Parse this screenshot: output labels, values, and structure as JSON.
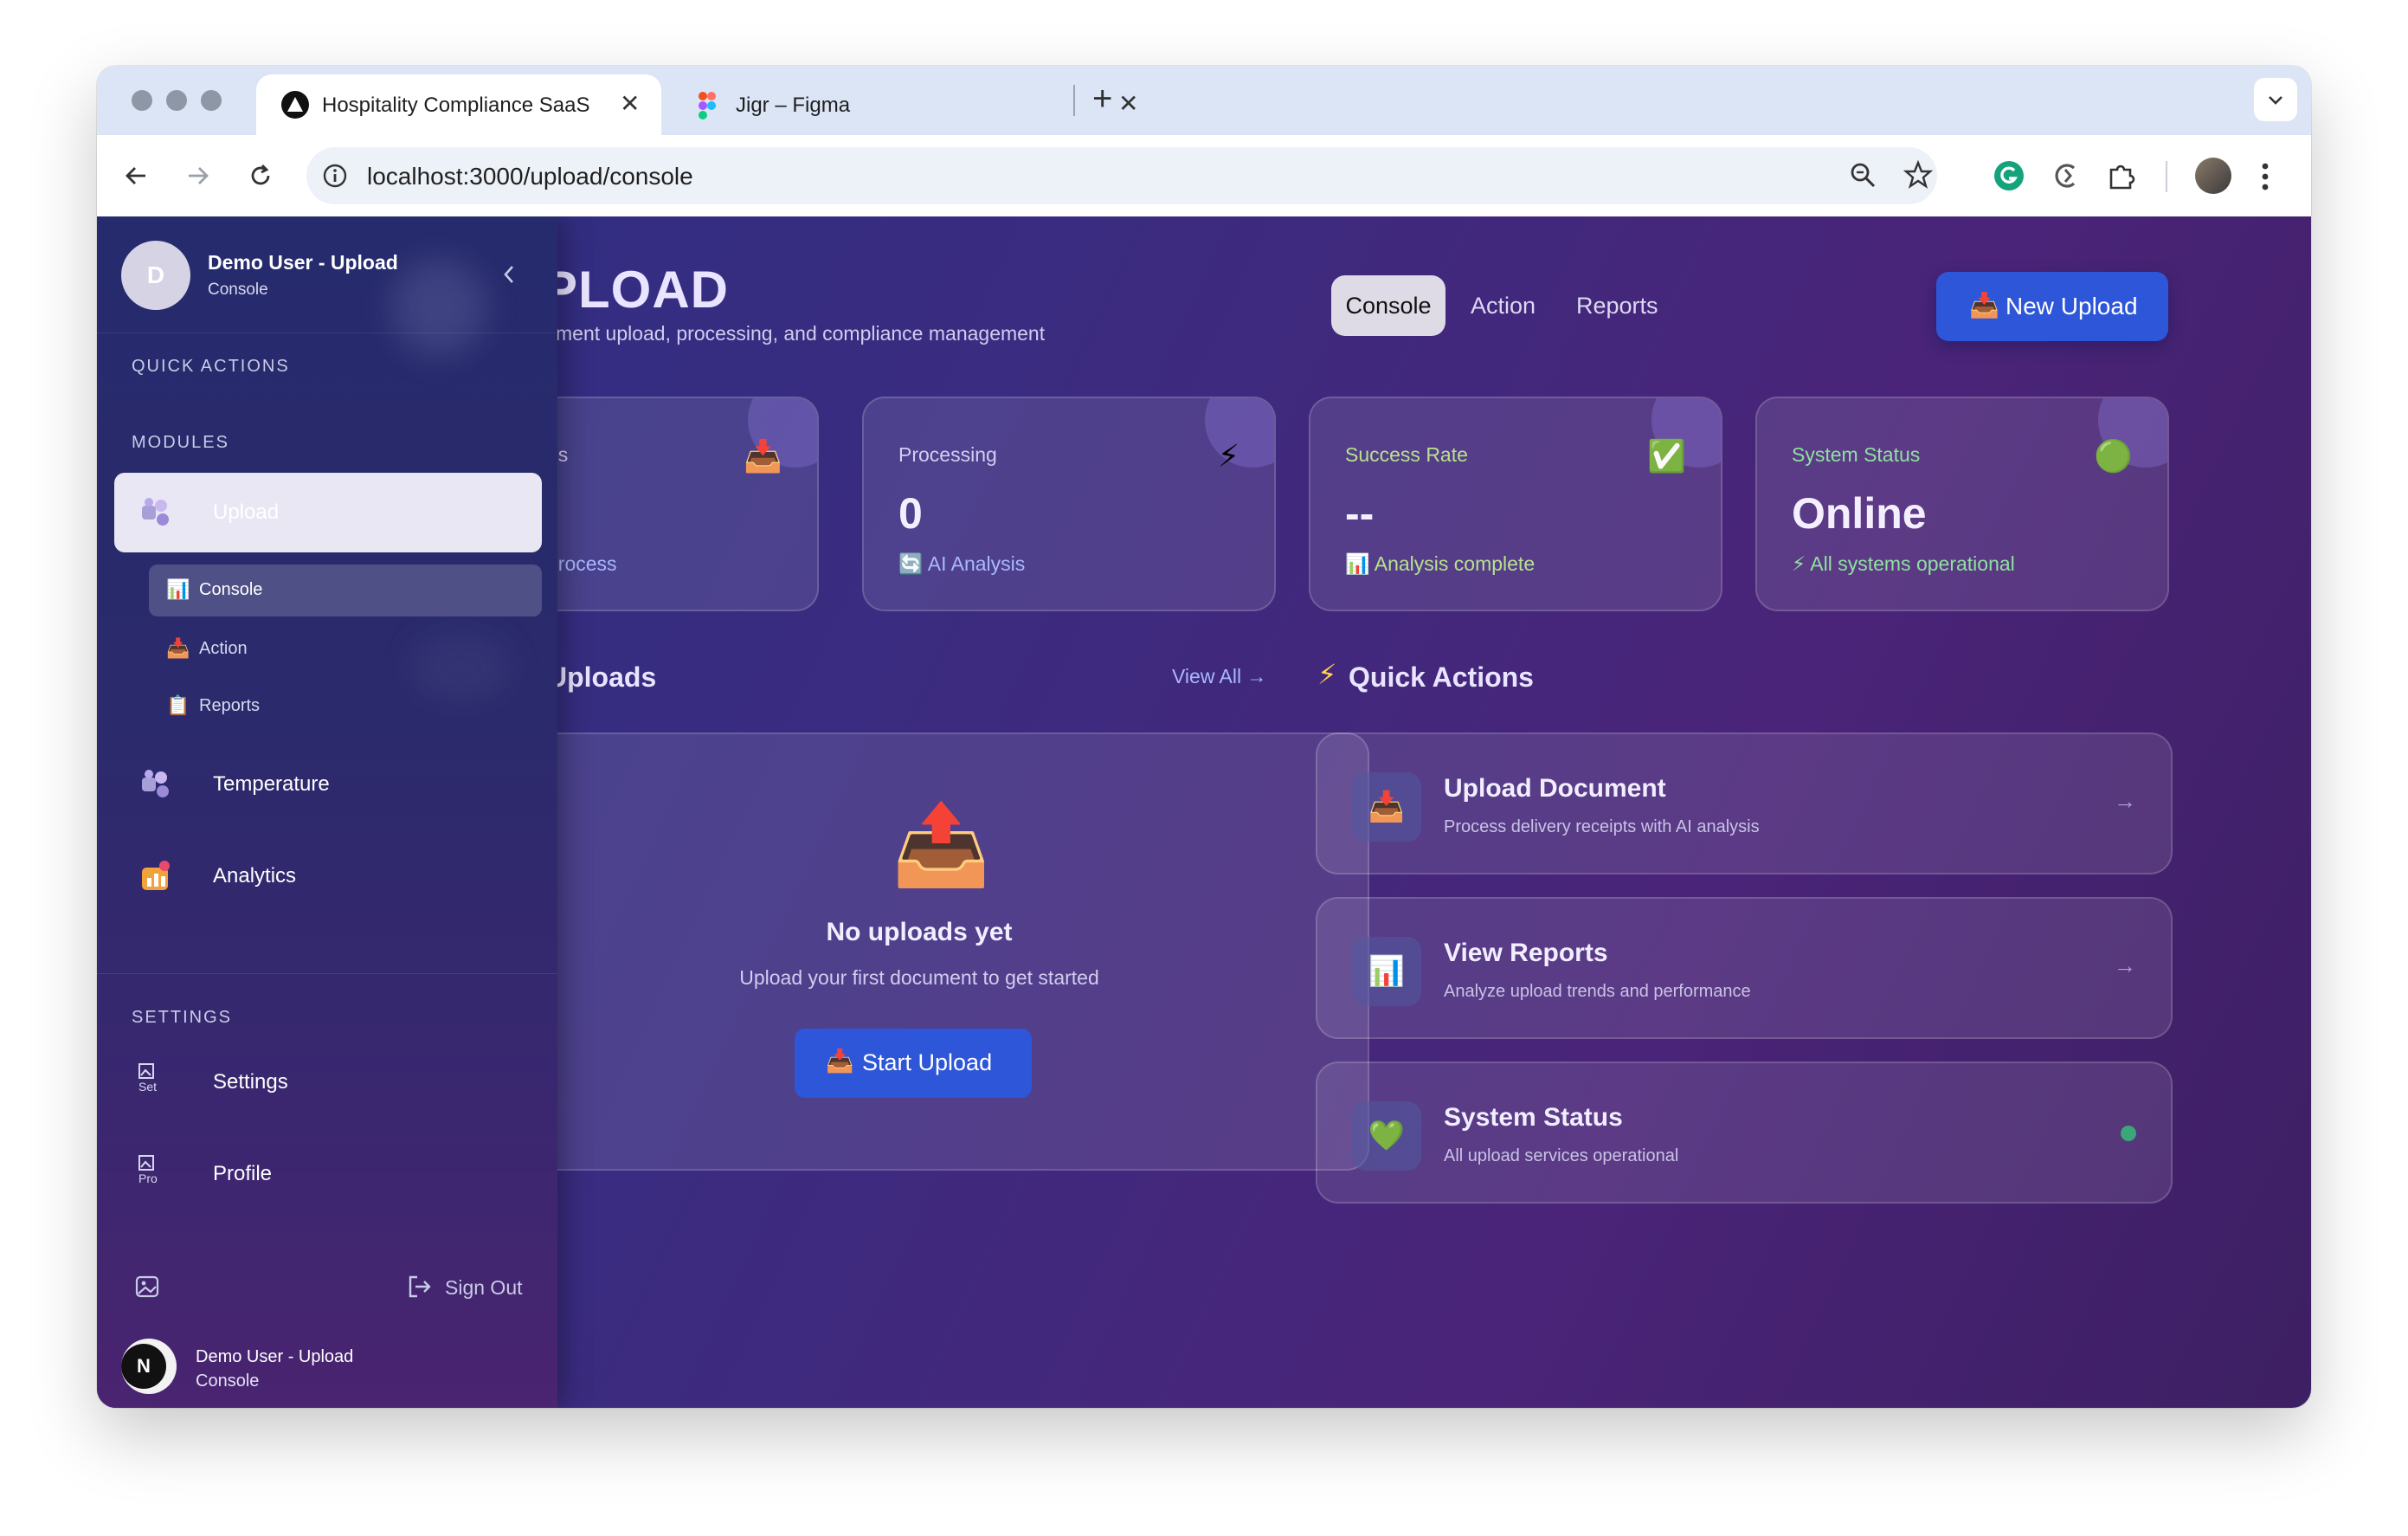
{
  "browser": {
    "tabs": [
      {
        "title": "Hospitality Compliance SaaS",
        "active": true,
        "icon": "triangle-logo-icon"
      },
      {
        "title": "Jigr – Figma",
        "active": false,
        "icon": "figma-icon"
      }
    ],
    "close_glyph": "✕",
    "new_tab_glyph": "+",
    "url": "localhost:3000/upload/console"
  },
  "sidebar": {
    "user": {
      "initial": "D",
      "name": "Demo User - Upload",
      "subtitle": "Console"
    },
    "quick_actions_heading": "QUICK ACTIONS",
    "modules_heading": "MODULES",
    "modules": [
      {
        "label": "Upload",
        "icon": "puzzle-icon",
        "active": true
      },
      {
        "label": "Temperature",
        "icon": "puzzle-icon",
        "active": false
      },
      {
        "label": "Analytics",
        "icon": "chart-box-icon",
        "active": false
      }
    ],
    "upload_subitems": [
      {
        "label": "Console",
        "icon": "📊",
        "active": true
      },
      {
        "label": "Action",
        "icon": "📥",
        "active": false
      },
      {
        "label": "Reports",
        "icon": "📋",
        "active": false
      }
    ],
    "settings_heading": "SETTINGS",
    "settings_items": [
      {
        "label": "Settings",
        "broken_img_alt": "Set"
      },
      {
        "label": "Profile",
        "broken_img_alt": "Pro"
      }
    ],
    "sign_out_label": "Sign Out",
    "footer_user": {
      "initial": "N",
      "name": "Demo User - Upload",
      "subtitle": "Console"
    }
  },
  "header": {
    "title_partial": "PLOAD",
    "subtitle_partial": "ment upload, processing, and compliance management",
    "tabs": [
      {
        "label": "Console",
        "active": true
      },
      {
        "label": "Action",
        "active": false
      },
      {
        "label": "Reports",
        "active": false
      }
    ],
    "new_upload_label": "New Upload",
    "new_upload_icon": "📥"
  },
  "stats": [
    {
      "label_partial": "ds",
      "value": "",
      "sub_partial": "process",
      "icon": "📥",
      "sub_color": "#a9b8ff"
    },
    {
      "label": "Processing",
      "value": "0",
      "sub": "🔄 AI Analysis",
      "icon": "⚡",
      "sub_color": "#a9b8ff"
    },
    {
      "label": "Success Rate",
      "value": "--",
      "sub": "📊 Analysis complete",
      "icon": "✅",
      "sub_color": "#b7e28c"
    },
    {
      "label": "System Status",
      "value": "Online",
      "sub": "⚡ All systems operational",
      "icon": "🟢",
      "sub_color": "#8fe0a0"
    }
  ],
  "recent_uploads": {
    "title_partial": "Uploads",
    "view_all": "View All →",
    "empty_icon": "📤",
    "empty_title": "No uploads yet",
    "empty_desc": "Upload your first document to get started",
    "start_button": "Start Upload",
    "start_icon": "📥"
  },
  "quick_actions": {
    "title": "Quick Actions",
    "title_icon": "⚡",
    "items": [
      {
        "title": "Upload Document",
        "desc": "Process delivery receipts with AI analysis",
        "icon": "📥",
        "trail": "→"
      },
      {
        "title": "View Reports",
        "desc": "Analyze upload trends and performance",
        "icon": "📊",
        "trail": "→"
      },
      {
        "title": "System Status",
        "desc": "All upload services operational",
        "icon": "💚",
        "trail": "dot"
      }
    ]
  },
  "colors": {
    "accent_button": "#2e56d8",
    "sidebar_active": "#e9e7f3",
    "status_dot": "#3aa67a"
  }
}
